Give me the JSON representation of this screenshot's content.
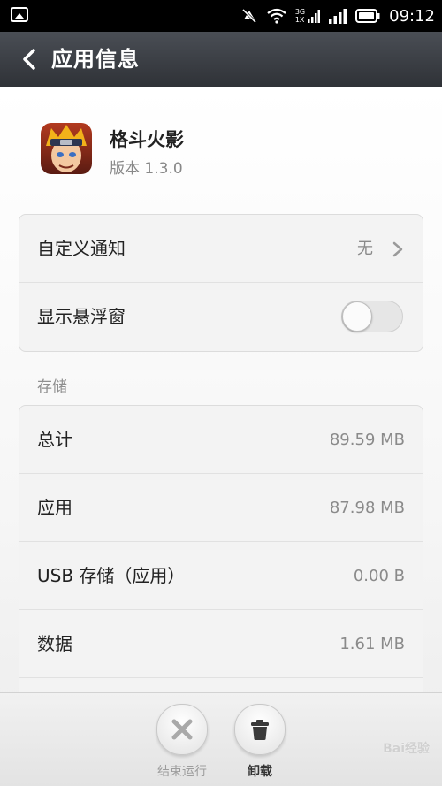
{
  "status_bar": {
    "network_top": "3G",
    "network_bottom": "1X",
    "time": "09:12"
  },
  "header": {
    "title": "应用信息"
  },
  "app": {
    "name": "格斗火影",
    "version": "版本 1.3.0"
  },
  "settings": {
    "notify_label": "自定义通知",
    "notify_value": "无",
    "float_label": "显示悬浮窗",
    "float_enabled": false
  },
  "storage": {
    "section_label": "存储",
    "rows": [
      {
        "label": "总计",
        "value": "89.59 MB"
      },
      {
        "label": "应用",
        "value": "87.98 MB"
      },
      {
        "label": "USB 存储（应用）",
        "value": "0.00 B"
      },
      {
        "label": "数据",
        "value": "1.61 MB"
      }
    ]
  },
  "actions": {
    "force_stop_label": "结束运行",
    "uninstall_label": "卸载"
  },
  "watermark": "Bai经验",
  "colors": {
    "titlebar": "#3a3d42",
    "toggle_off": "#e6e6e6"
  }
}
